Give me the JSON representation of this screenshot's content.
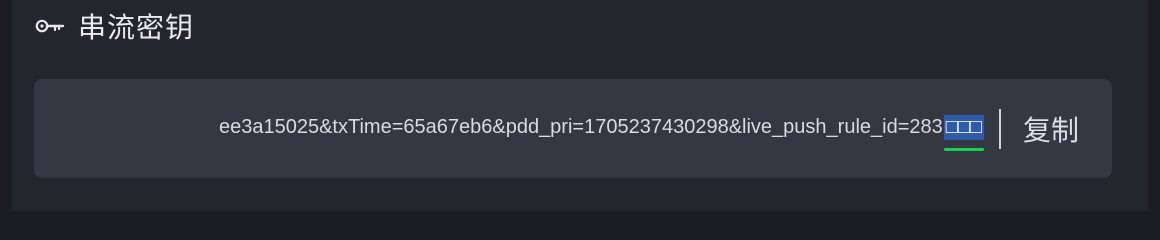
{
  "section": {
    "icon": "key-icon",
    "title": "串流密钥"
  },
  "stream_key": {
    "visible_text": "ee3a15025&txTime=65a67eb6&pdd_pri=1705237430298&live_push_rule_id=283",
    "selected_text": "□□□"
  },
  "actions": {
    "copy_label": "复制"
  },
  "colors": {
    "page_background": "#1c1d22",
    "panel_background": "#24262d",
    "field_background": "#353742",
    "selection_highlight": "#2f5ca8",
    "cursor_underline": "#13d34d"
  }
}
